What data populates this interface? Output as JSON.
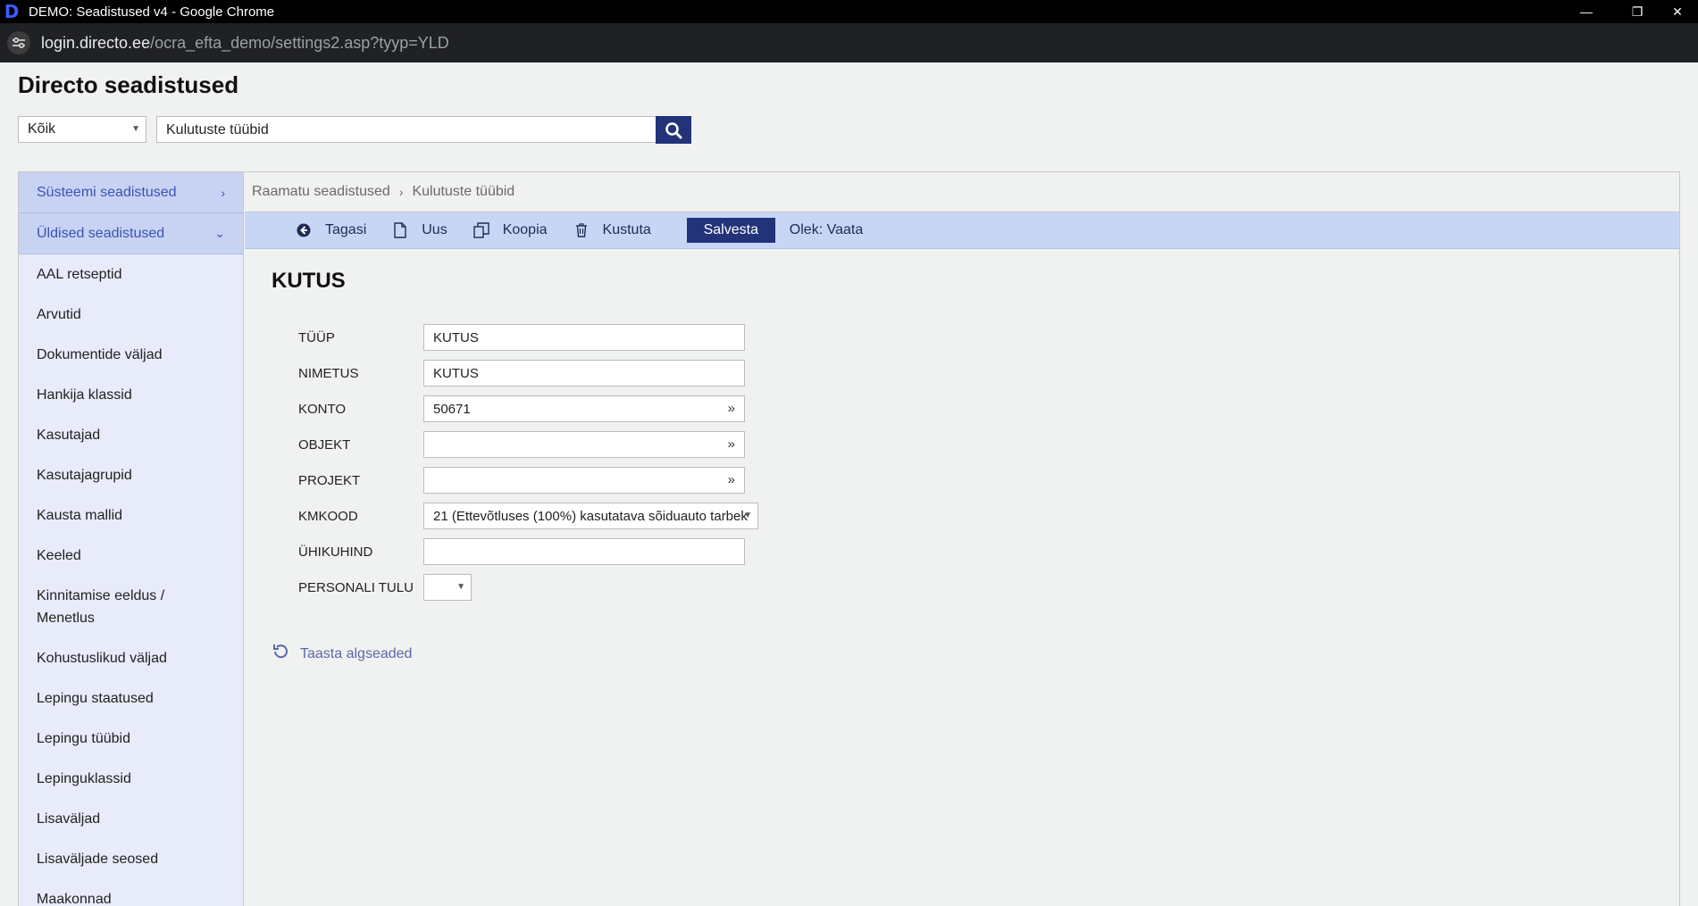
{
  "window": {
    "title": "DEMO: Seadistused v4 - Google Chrome",
    "minimize_glyph": "—",
    "restore_glyph": "❐",
    "close_glyph": "✕"
  },
  "address": {
    "host": "login.directo.ee",
    "path": "/ocra_efta_demo/settings2.asp?tyyp=YLD"
  },
  "page": {
    "title": "Directo seadistused"
  },
  "search": {
    "scope_value": "Kõik",
    "query": "Kulutuste tüübid"
  },
  "sidebar": {
    "sections": [
      {
        "label": "Süsteemi seadistused",
        "chevron": "›"
      },
      {
        "label": "Üldised seadistused",
        "chevron": "⌄"
      }
    ],
    "items": [
      "AAL retseptid",
      "Arvutid",
      "Dokumentide väljad",
      "Hankija klassid",
      "Kasutajad",
      "Kasutajagrupid",
      "Kausta mallid",
      "Keeled",
      "Kinnitamise eeldus / Menetlus",
      "Kohustuslikud väljad",
      "Lepingu staatused",
      "Lepingu tüübid",
      "Lepinguklassid",
      "Lisaväljad",
      "Lisaväljade seosed",
      "Maakonnad"
    ]
  },
  "breadcrumb": {
    "parent": "Raamatu seadistused",
    "separator": "›",
    "current": "Kulutuste tüübid"
  },
  "toolbar": {
    "back": "Tagasi",
    "new": "Uus",
    "copy": "Koopia",
    "delete": "Kustuta",
    "save": "Salvesta",
    "status": "Olek: Vaata"
  },
  "record": {
    "title": "KUTUS",
    "fields": {
      "tyyp": {
        "label": "TÜÜP",
        "value": "KUTUS"
      },
      "nimetus": {
        "label": "NIMETUS",
        "value": "KUTUS"
      },
      "konto": {
        "label": "KONTO",
        "value": "50671"
      },
      "objekt": {
        "label": "OBJEKT",
        "value": ""
      },
      "projekt": {
        "label": "PROJEKT",
        "value": ""
      },
      "kmkood": {
        "label": "KMKOOD",
        "value": "21 (Ettevõtluses (100%) kasutatava sõiduauto tarbek"
      },
      "yhikuhind": {
        "label": "ÜHIKUHIND",
        "value": ""
      },
      "personali_tulu": {
        "label": "PERSONALI TULU",
        "value": ""
      }
    },
    "reset_label": "Taasta algseaded"
  },
  "colors": {
    "accent": "#22337a",
    "sidebar_bg": "#e8ebf9",
    "toolbar_bg": "#c8d6f6"
  }
}
